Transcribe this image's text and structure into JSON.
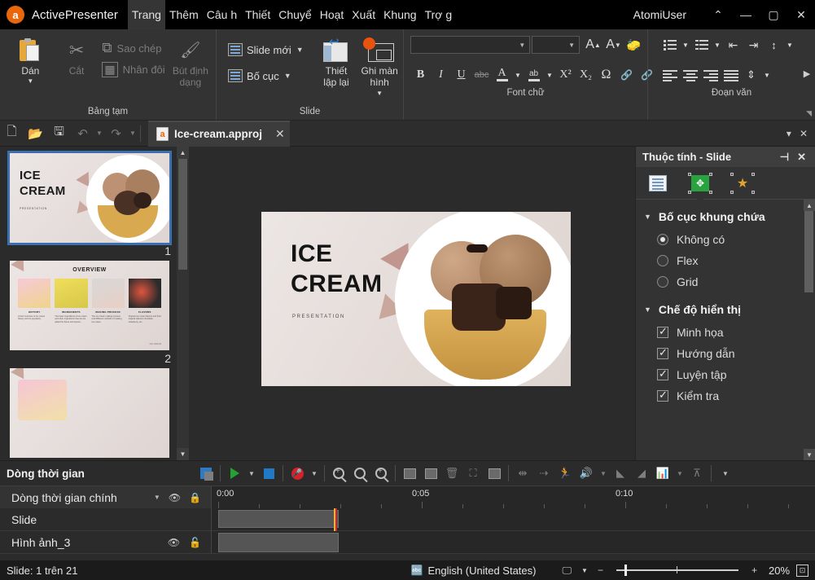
{
  "titlebar": {
    "app_name": "ActivePresenter",
    "logo_glyph": "a",
    "menus": [
      {
        "label": "Trang",
        "active": true
      },
      {
        "label": "Thêm",
        "active": false
      },
      {
        "label": "Câu h",
        "active": false
      },
      {
        "label": "Thiết",
        "active": false
      },
      {
        "label": "Chuyể",
        "active": false
      },
      {
        "label": "Hoạt",
        "active": false
      },
      {
        "label": "Xuất",
        "active": false
      },
      {
        "label": "Khung",
        "active": false
      },
      {
        "label": "Trợ g",
        "active": false
      }
    ],
    "user": "AtomiUser",
    "collapse": "⌃",
    "minimize": "—",
    "maximize": "▢",
    "close": "✕"
  },
  "ribbon": {
    "clipboard": {
      "label": "Bảng tạm",
      "paste": "Dán",
      "cut": "Cắt",
      "copy": "Sao chép",
      "duplicate": "Nhân đôi",
      "format_painter": "Bút định dạng"
    },
    "slide": {
      "label": "Slide",
      "new_slide": "Slide mới",
      "layout": "Bố cục",
      "reset": "Thiết lập lại",
      "record": "Ghi màn hình"
    },
    "font": {
      "label": "Font chữ",
      "font_name": "",
      "font_size": "",
      "grow": "A",
      "shrink": "A",
      "clear_format": "⌫",
      "bold": "B",
      "italic": "I",
      "underline": "U",
      "strikethrough": "abc",
      "font_color": "A",
      "highlight": "ab",
      "superscript": "X²",
      "subscript": "X₂",
      "symbol": "Ω",
      "insert_link": "🔗",
      "remove_link": "🔗"
    },
    "paragraph": {
      "label": "Đoạn văn"
    }
  },
  "qat": {
    "new": "new-file",
    "open": "open-folder",
    "save": "save-disk",
    "undo": "undo-arrow",
    "redo": "redo-arrow",
    "tab_title": "Ice-cream.approj",
    "tab_icon_glyph": "a",
    "tab_close": "✕",
    "panel_menu": "▾",
    "panel_close": "✕"
  },
  "slides": [
    {
      "number": "1",
      "selected": true,
      "title_line1": "ICE",
      "title_line2": "CREAM",
      "subtitle": "PRESENTATION"
    },
    {
      "number": "2",
      "selected": false,
      "heading": "OVERVIEW",
      "cards": [
        {
          "title": "HISTORY",
          "body": "A brief overview of ice cream history and its popularity."
        },
        {
          "title": "INGREDIENTS",
          "body": "The basic ingredients of ice cream and other ingredients that can be added for flavor and texture."
        },
        {
          "title": "MAKING PROCESS",
          "body": "The ice cream making process and different methods of making ice cream."
        },
        {
          "title": "FLAVORS",
          "body": "Popular ice cream flavors and their original classics chocolate, strawberry, etc."
        }
      ],
      "badge": "ICE CREAM"
    }
  ],
  "canvas": {
    "title_line1": "ICE",
    "title_line2": "CREAM",
    "subtitle": "PRESENTATION"
  },
  "properties": {
    "header": "Thuộc tính - Slide",
    "pin": "⊣",
    "close": "✕",
    "tabs": [
      {
        "name": "slide-properties",
        "active": false
      },
      {
        "name": "size-and-position",
        "active": true
      },
      {
        "name": "animation",
        "active": false
      }
    ],
    "sections": [
      {
        "title": "Bố cục khung chứa",
        "type": "radio",
        "options": [
          {
            "label": "Không có",
            "checked": true
          },
          {
            "label": "Flex",
            "checked": false
          },
          {
            "label": "Grid",
            "checked": false
          }
        ]
      },
      {
        "title": "Chế độ hiển thị",
        "type": "checkbox",
        "options": [
          {
            "label": "Minh họa",
            "checked": true
          },
          {
            "label": "Hướng dẫn",
            "checked": true
          },
          {
            "label": "Luyện tập",
            "checked": true
          },
          {
            "label": "Kiểm tra",
            "checked": true
          }
        ]
      }
    ]
  },
  "timeline": {
    "title": "Dòng thời gian",
    "main_track": "Dòng thời gian chính",
    "ruler_labels": [
      "0:00",
      "0:05",
      "0:10"
    ],
    "rows": [
      {
        "name": "Slide",
        "has_icons": false
      },
      {
        "name": "Hình ảnh_3",
        "has_icons": true
      }
    ]
  },
  "statusbar": {
    "slide_info": "Slide: 1 trên 21",
    "language": "English (United States)",
    "zoom_value": "20%",
    "zoom_minus": "−",
    "zoom_plus": "+"
  },
  "colors": {
    "accent_orange": "#e8670c",
    "selection_blue": "#3a6fb0",
    "play_green": "#25a033",
    "record_red": "#d4222a",
    "stop_blue": "#2178c4"
  }
}
